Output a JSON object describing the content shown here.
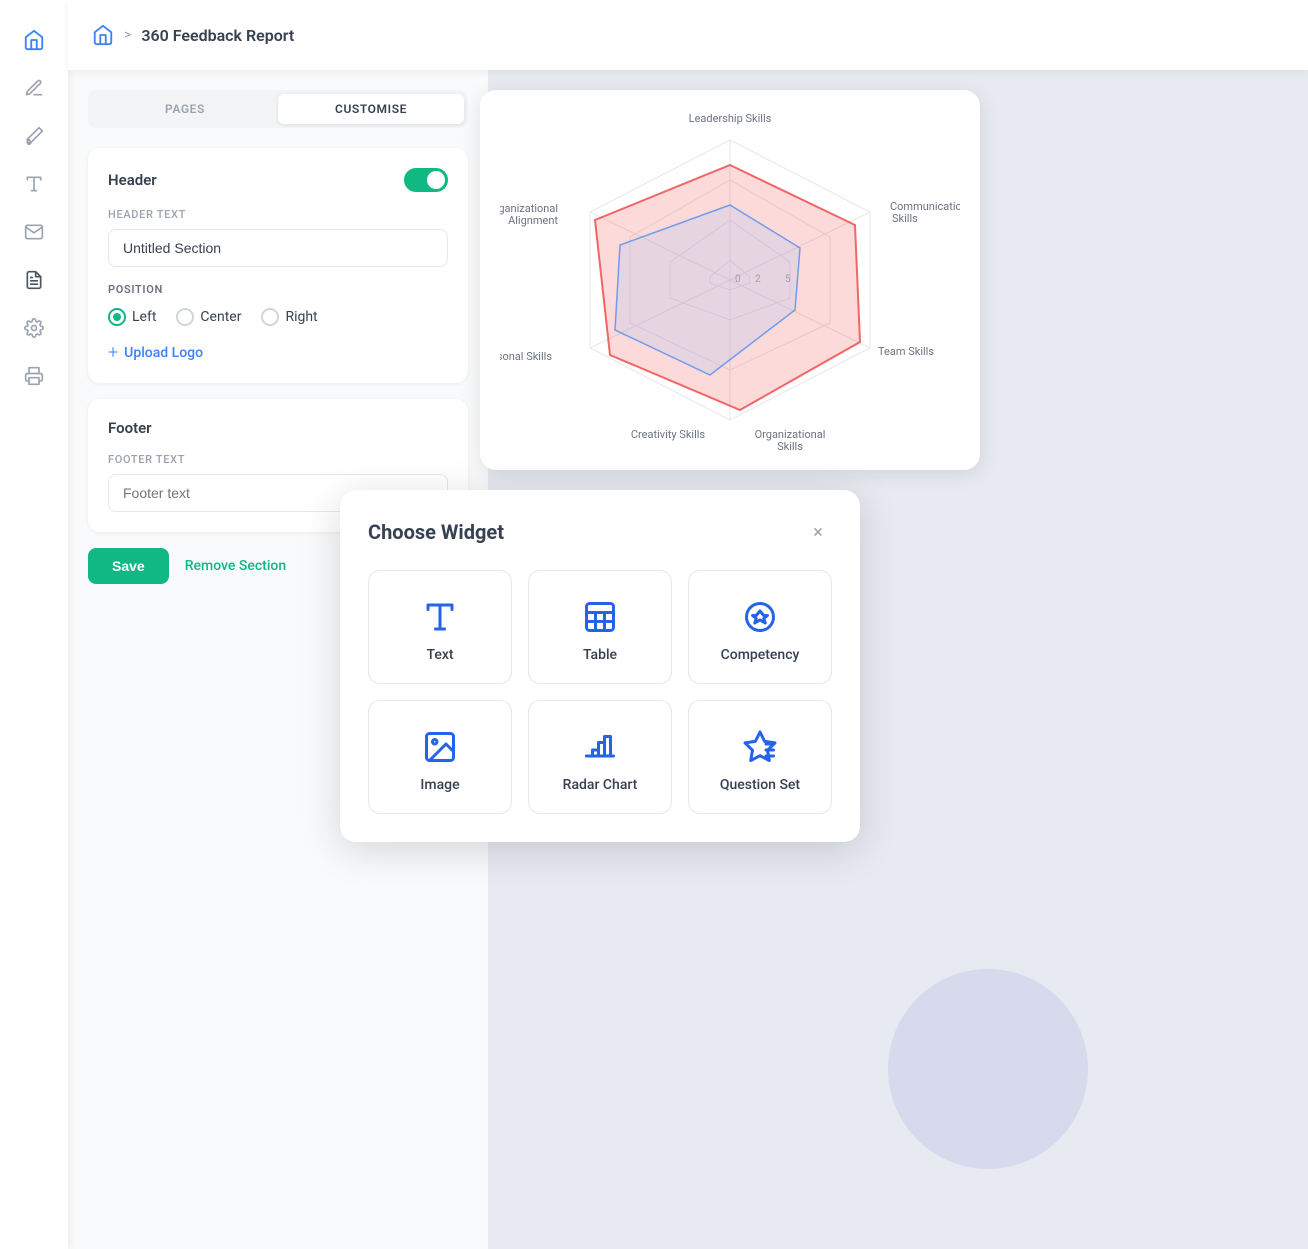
{
  "topbar": {
    "home_label": "Home",
    "breadcrumb_separator": ">",
    "page_title": "360 Feedback Report"
  },
  "tabs": {
    "pages_label": "PAGES",
    "customise_label": "CUSTOMISE",
    "active": "customise"
  },
  "header_section": {
    "title": "Header",
    "header_text_label": "Header text",
    "header_text_value": "Untitled Section",
    "position_label": "POSITION",
    "position_left": "Left",
    "position_center": "Center",
    "position_right": "Right",
    "upload_logo_label": "Upload Logo"
  },
  "footer_section": {
    "title": "Footer",
    "footer_text_label": "Footer text",
    "footer_text_placeholder": "Footer text"
  },
  "actions": {
    "save_label": "Save",
    "remove_label": "Remove Section"
  },
  "widget_dialog": {
    "title": "Choose Widget",
    "close_label": "×",
    "widgets": [
      {
        "id": "text",
        "label": "Text",
        "icon": "text"
      },
      {
        "id": "table",
        "label": "Table",
        "icon": "table"
      },
      {
        "id": "competency",
        "label": "Competency",
        "icon": "competency"
      },
      {
        "id": "image",
        "label": "Image",
        "icon": "image"
      },
      {
        "id": "radar-chart",
        "label": "Radar Chart",
        "icon": "radar-chart"
      },
      {
        "id": "question-set",
        "label": "Question Set",
        "icon": "question-set"
      }
    ]
  },
  "sidebar": {
    "items": [
      {
        "id": "home",
        "icon": "home"
      },
      {
        "id": "edit",
        "icon": "pencil"
      },
      {
        "id": "brush",
        "icon": "brush"
      },
      {
        "id": "text-style",
        "icon": "text-style"
      },
      {
        "id": "mail",
        "icon": "mail"
      },
      {
        "id": "document",
        "icon": "document"
      },
      {
        "id": "settings",
        "icon": "settings"
      },
      {
        "id": "print",
        "icon": "print"
      }
    ]
  },
  "radar_chart": {
    "labels": [
      "Leadership Skills",
      "Communication Skills",
      "Team Skills",
      "Organizational Skills",
      "Creativity Skills",
      "Interpersonal Skills",
      "Organizational Alignment"
    ],
    "scale_values": [
      "0",
      "2",
      "5"
    ]
  }
}
